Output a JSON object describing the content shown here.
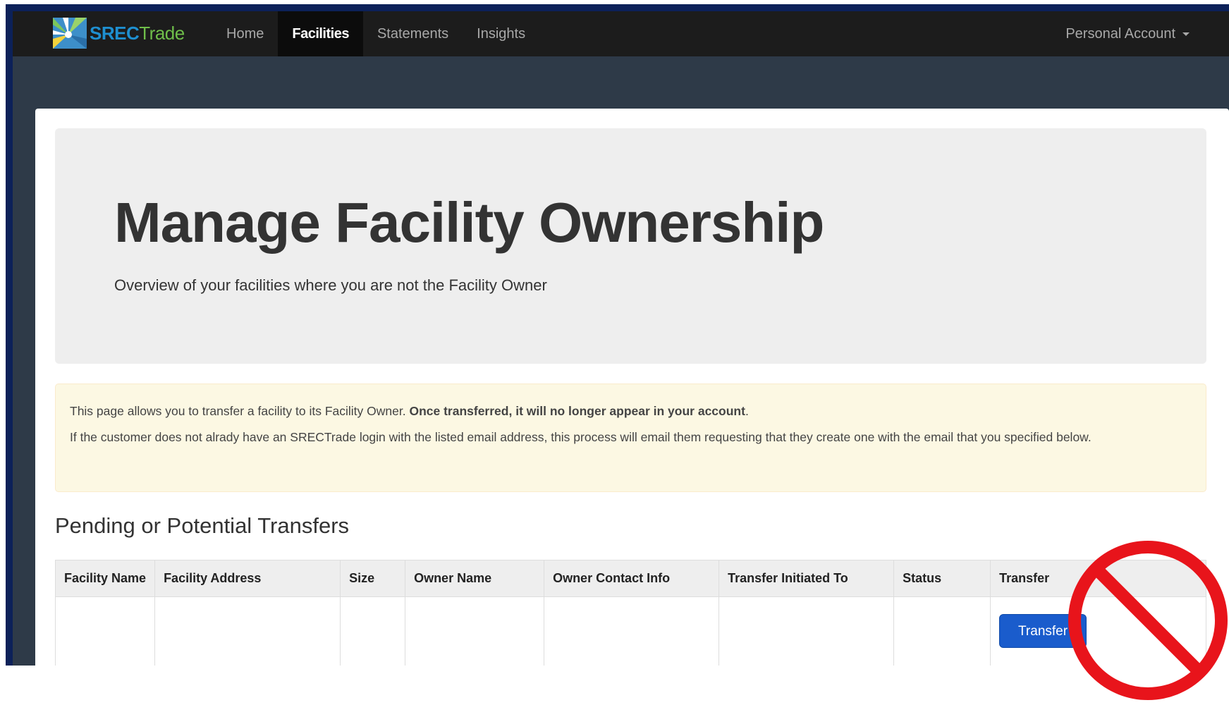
{
  "brand": {
    "part1": "SREC",
    "part2": "Trade"
  },
  "nav": {
    "items": [
      "Home",
      "Facilities",
      "Statements",
      "Insights"
    ],
    "active": "Facilities",
    "account": "Personal Account"
  },
  "hero": {
    "title": "Manage Facility Ownership",
    "subtitle": "Overview of your facilities where you are not the Facility Owner"
  },
  "alert": {
    "line1_prefix": "This page allows you to transfer a facility to its Facility Owner. ",
    "line1_bold": "Once transferred, it will no longer appear in your account",
    "line1_suffix": ".",
    "line2": "If the customer does not alrady have an SRECTrade login with the listed email address, this process will email them requesting that they create one with the email that you specified below."
  },
  "section": {
    "title": "Pending or Potential Transfers"
  },
  "table": {
    "headers": [
      "Facility Name",
      "Facility Address",
      "Size",
      "Owner Name",
      "Owner Contact Info",
      "Transfer Initiated To",
      "Status",
      "Transfer"
    ],
    "rows": [
      {
        "transfer_button": "Transfer"
      }
    ]
  },
  "colors": {
    "accent": "#1a5ccc",
    "alert_bg": "#fcf8e3",
    "no_sign": "#e8141b"
  },
  "icons": {
    "logo": "srectrade-sunburst-icon",
    "caret": "caret-down-icon",
    "overlay": "no-sign-icon"
  }
}
